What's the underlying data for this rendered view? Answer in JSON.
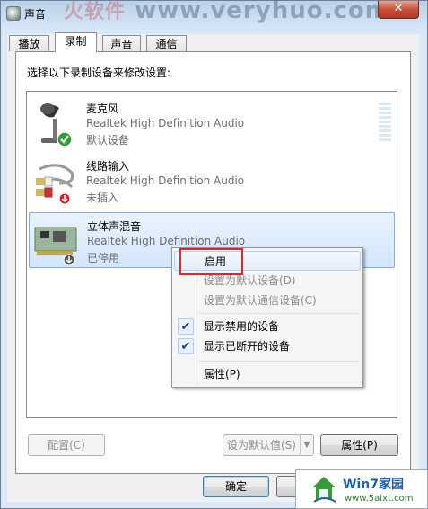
{
  "window": {
    "title": "声音",
    "close_glyph": "✕"
  },
  "watermark": {
    "cn": "火软件",
    "url": "www.veryhuo.com"
  },
  "tabs": [
    {
      "label": "播放",
      "active": false
    },
    {
      "label": "录制",
      "active": true
    },
    {
      "label": "声音",
      "active": false
    },
    {
      "label": "通信",
      "active": false
    }
  ],
  "prompt": "选择以下录制设备来修改设置:",
  "devices": [
    {
      "name": "麦克风",
      "driver": "Realtek High Definition Audio",
      "status": "默认设备",
      "icon": "microphone-icon",
      "badge": "default-check"
    },
    {
      "name": "线路输入",
      "driver": "Realtek High Definition Audio",
      "status": "未插入",
      "icon": "line-in-cable-icon",
      "badge": "unplugged"
    },
    {
      "name": "立体声混音",
      "driver": "Realtek High Definition Audio",
      "status": "已停用",
      "icon": "sound-card-icon",
      "badge": "disabled",
      "selected": true
    }
  ],
  "context_menu": {
    "items": [
      {
        "label": "启用",
        "enabled": true,
        "highlighted": true
      },
      {
        "label": "设置为默认设备(D)",
        "enabled": false
      },
      {
        "label": "设置为默认通信设备(C)",
        "enabled": false
      },
      {
        "label": "显示禁用的设备",
        "checked": true
      },
      {
        "label": "显示已断开的设备",
        "checked": true
      },
      {
        "label": "属性(P)",
        "enabled": true
      }
    ],
    "check_glyph": "✔"
  },
  "buttons": {
    "configure": "配置(C)",
    "set_default": "设为默认值(S)",
    "properties": "属性(P)",
    "ok": "确定"
  },
  "logo": {
    "text": "Win7家园",
    "url": "www.5aixt.com"
  },
  "colors": {
    "highlight_box": "#e0262b",
    "selection": "#d3e6fb",
    "check": "#1a3a88"
  }
}
